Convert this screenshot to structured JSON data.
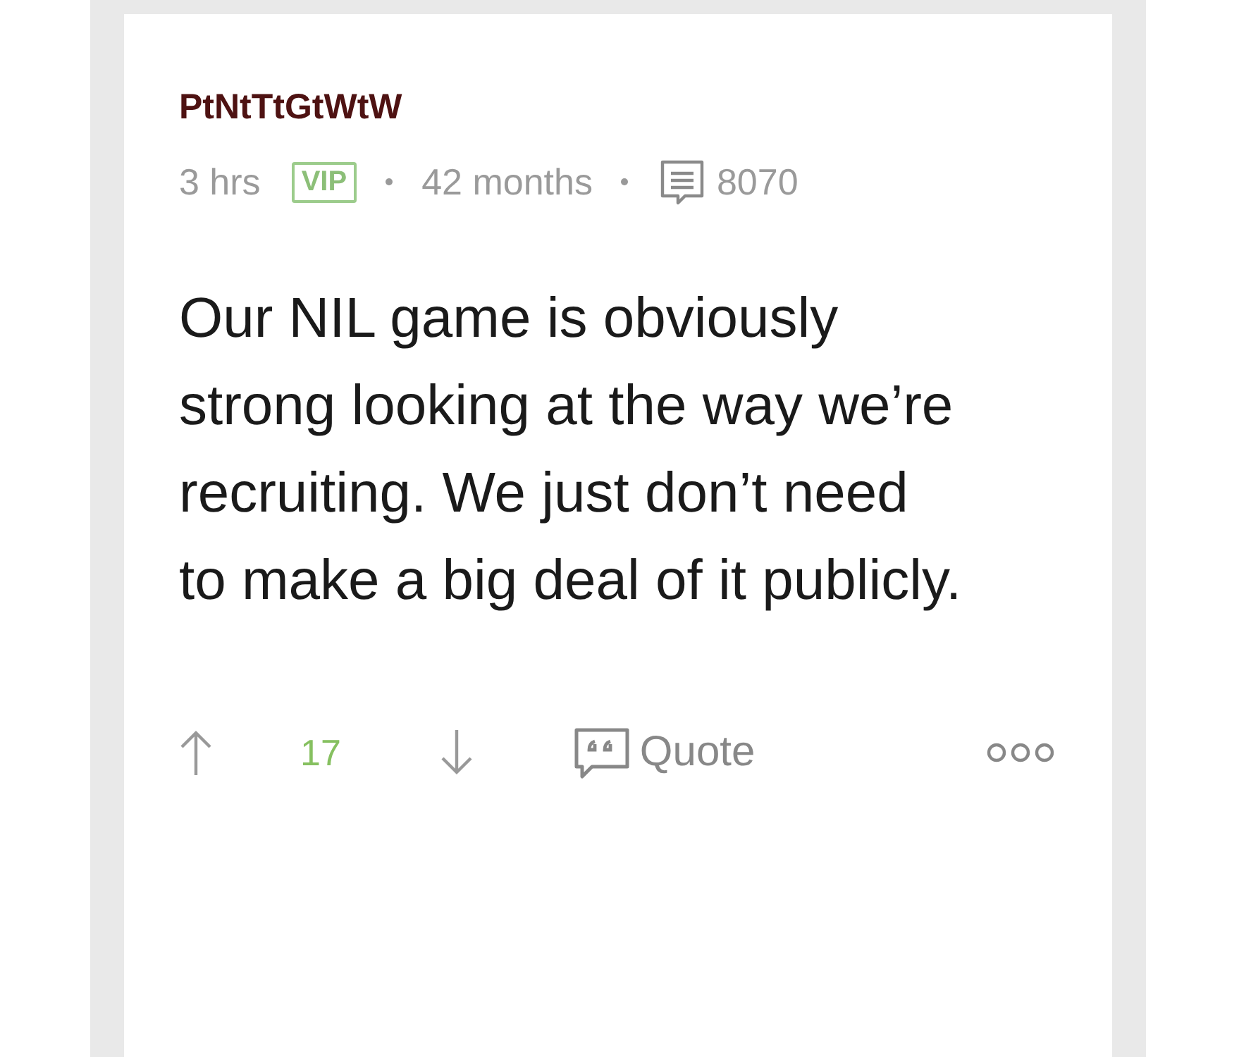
{
  "post": {
    "author": "PtNtTtGtWtW",
    "time": "3 hrs",
    "badge": "VIP",
    "tenure": "42 months",
    "post_count": "8070",
    "body": "Our NIL game is obviously strong looking at the way we’re recruiting. We just don’t need to make a big deal of it publicly.",
    "votes": "17",
    "quote_label": "Quote"
  }
}
